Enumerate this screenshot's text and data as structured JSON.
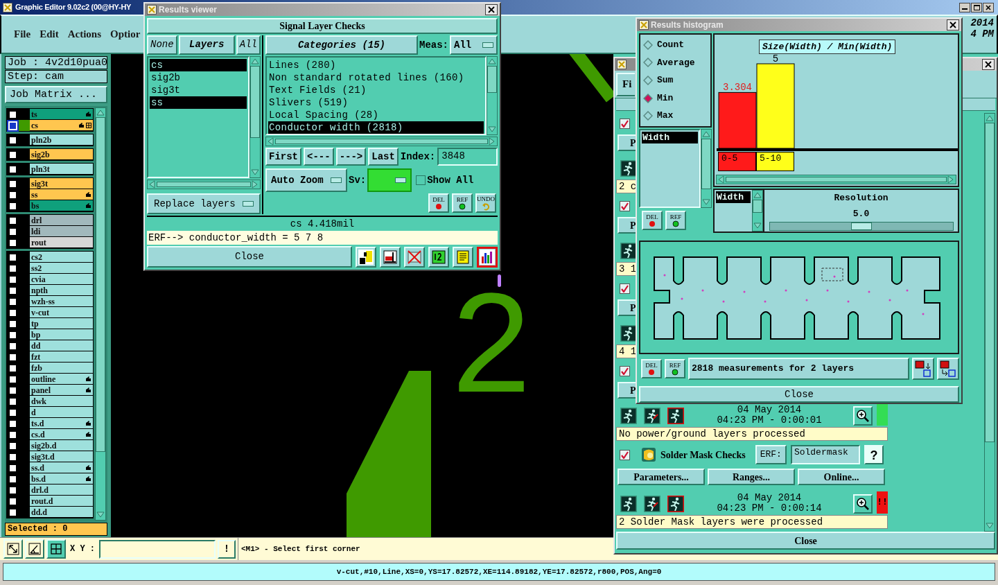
{
  "main_window": {
    "title": "Graphic Editor 9.02c2 (00@HY-HY",
    "menu": [
      "File",
      "Edit",
      "Actions",
      "Optior"
    ],
    "clock": [
      "2014",
      "4 PM"
    ]
  },
  "layer_panel": {
    "job": "Job : 4v2d10pua0",
    "step": "Step: cam",
    "job_matrix_button": "Job Matrix ...",
    "selected_count": "Selected : 0",
    "groups": [
      {
        "layers": [
          {
            "name": "ts",
            "color": "#0fa07c",
            "selected": false,
            "hand": true,
            "grid": false
          },
          {
            "name": "cs",
            "color": "#ffc64f",
            "selected": true,
            "displayed": true,
            "hand": true,
            "grid": true
          }
        ]
      },
      {
        "layers": [
          {
            "name": "pln2b",
            "color": "#9ee0dc",
            "selected": false,
            "hand": false,
            "grid": false
          }
        ]
      },
      {
        "layers": [
          {
            "name": "sig2b",
            "color": "#ffc64f",
            "selected": false,
            "hand": false,
            "grid": false
          }
        ]
      },
      {
        "layers": [
          {
            "name": "pln3t",
            "color": "#9ee0dc",
            "selected": false,
            "hand": false,
            "grid": false
          }
        ]
      },
      {
        "layers": [
          {
            "name": "sig3t",
            "color": "#ffc64f",
            "selected": false,
            "hand": false,
            "grid": false
          },
          {
            "name": "ss",
            "color": "#ffc64f",
            "selected": false,
            "hand": true,
            "grid": false
          },
          {
            "name": "bs",
            "color": "#0fa07c",
            "selected": false,
            "hand": true,
            "grid": false
          }
        ]
      },
      {
        "layers": [
          {
            "name": "drl",
            "color": "#a1b8bc",
            "selected": false,
            "hand": false,
            "grid": false
          },
          {
            "name": "ldi",
            "color": "#a1b8bc",
            "selected": false,
            "hand": false,
            "grid": false
          },
          {
            "name": "rout",
            "color": "#d6d6d6",
            "selected": false,
            "hand": false,
            "grid": false
          }
        ]
      },
      {
        "layers": [
          {
            "name": "cs2",
            "color": "#9ee0dc",
            "selected": false,
            "hand": false,
            "grid": false
          },
          {
            "name": "ss2",
            "color": "#9ee0dc",
            "selected": false,
            "hand": false,
            "grid": false
          },
          {
            "name": "cvia",
            "color": "#9ee0dc",
            "selected": false,
            "hand": false,
            "grid": false
          },
          {
            "name": "npth",
            "color": "#9ee0dc",
            "selected": false,
            "hand": false,
            "grid": false
          },
          {
            "name": "wzh-ss",
            "color": "#9ee0dc",
            "selected": false,
            "hand": false,
            "grid": false
          },
          {
            "name": "v-cut",
            "color": "#9ee0dc",
            "selected": false,
            "hand": false,
            "grid": false
          },
          {
            "name": "tp",
            "color": "#9ee0dc",
            "selected": false,
            "hand": false,
            "grid": false
          },
          {
            "name": "bp",
            "color": "#9ee0dc",
            "selected": false,
            "hand": false,
            "grid": false
          },
          {
            "name": "dd",
            "color": "#9ee0dc",
            "selected": false,
            "hand": false,
            "grid": false
          },
          {
            "name": "fzt",
            "color": "#9ee0dc",
            "selected": false,
            "hand": false,
            "grid": false
          },
          {
            "name": "fzb",
            "color": "#9ee0dc",
            "selected": false,
            "hand": false,
            "grid": false
          },
          {
            "name": "outline",
            "color": "#9ee0dc",
            "selected": false,
            "hand": true,
            "grid": false
          },
          {
            "name": "panel",
            "color": "#9ee0dc",
            "selected": false,
            "hand": true,
            "grid": false
          },
          {
            "name": "dwk",
            "color": "#9ee0dc",
            "selected": false,
            "hand": false,
            "grid": false
          },
          {
            "name": "d",
            "color": "#9ee0dc",
            "selected": false,
            "hand": false,
            "grid": false
          },
          {
            "name": "ts.d",
            "color": "#9ee0dc",
            "selected": false,
            "hand": true,
            "grid": false
          },
          {
            "name": "cs.d",
            "color": "#9ee0dc",
            "selected": false,
            "hand": true,
            "grid": false
          },
          {
            "name": "sig2b.d",
            "color": "#9ee0dc",
            "selected": false,
            "hand": false,
            "grid": false
          },
          {
            "name": "sig3t.d",
            "color": "#9ee0dc",
            "selected": false,
            "hand": false,
            "grid": false
          },
          {
            "name": "ss.d",
            "color": "#9ee0dc",
            "selected": false,
            "hand": true,
            "grid": false
          },
          {
            "name": "bs.d",
            "color": "#9ee0dc",
            "selected": false,
            "hand": true,
            "grid": false
          },
          {
            "name": "drl.d",
            "color": "#9ee0dc",
            "selected": false,
            "hand": false,
            "grid": false
          },
          {
            "name": "rout.d",
            "color": "#9ee0dc",
            "selected": false,
            "hand": false,
            "grid": false
          },
          {
            "name": "dd.d",
            "color": "#9ee0dc",
            "selected": false,
            "hand": false,
            "grid": false
          }
        ]
      }
    ]
  },
  "canvas": {
    "label": "2"
  },
  "results_viewer": {
    "title": "Results viewer",
    "heading": "Signal Layer Checks",
    "layer_buttons": [
      {
        "label": "None",
        "kind": "button"
      },
      {
        "label": "Layers",
        "kind": "label"
      },
      {
        "label": "All",
        "kind": "button"
      }
    ],
    "layers": [
      {
        "name": "cs",
        "selected": true
      },
      {
        "name": "sig2b",
        "selected": false
      },
      {
        "name": "sig3t",
        "selected": false
      },
      {
        "name": "ss",
        "selected": true
      }
    ],
    "replace_button": "Replace layers",
    "categories_header": "Categories (15)",
    "meas_label": "Meas:",
    "meas_value": "All",
    "categories": [
      {
        "label": "Lines (280)",
        "selected": false
      },
      {
        "label": "Non standard rotated lines (160)",
        "selected": false
      },
      {
        "label": "Text Fields (21)",
        "selected": false
      },
      {
        "label": "Slivers (519)",
        "selected": false
      },
      {
        "label": "Local Spacing (28)",
        "selected": false
      },
      {
        "label": "Conductor width (2818)",
        "selected": true
      }
    ],
    "nav_buttons": [
      "First",
      "<---",
      "--->",
      "Last"
    ],
    "index_label": "Index:",
    "index_value": "3848",
    "zoom_button": "Auto Zoom",
    "sv_label": "Sv:",
    "show_all": {
      "label": "Show All",
      "checked": false
    },
    "action_buttons": [
      {
        "label": "DEL",
        "kind": "del"
      },
      {
        "label": "REF",
        "kind": "ref"
      },
      {
        "label": "UNDO",
        "kind": "undo"
      }
    ],
    "reading": "cs 4.418mil",
    "erf_line": "ERF--> conductor_width = 5 7 8",
    "close_button": "Close",
    "tools": [
      {
        "kind": "info",
        "selected": false
      },
      {
        "kind": "marker",
        "selected": false
      },
      {
        "kind": "crossed",
        "selected": false
      },
      {
        "kind": "counter",
        "selected": false
      },
      {
        "kind": "notes",
        "selected": false
      },
      {
        "kind": "histogram",
        "selected": true
      }
    ]
  },
  "results_histogram": {
    "title": "Results histogram",
    "modes": [
      {
        "label": "Count",
        "selected": false
      },
      {
        "label": "Average",
        "selected": false
      },
      {
        "label": "Sum",
        "selected": false
      },
      {
        "label": "Min",
        "selected": true
      },
      {
        "label": "Max",
        "selected": false
      }
    ],
    "attributes": [
      {
        "label": "Width",
        "selected": true
      }
    ],
    "side_buttons": [
      {
        "label": "DEL",
        "kind": "del"
      },
      {
        "label": "REF",
        "kind": "ref"
      }
    ],
    "chart_data": {
      "type": "bar",
      "title": "Size(Width) / Min(Width)",
      "categories": [
        "0-5",
        "5-10"
      ],
      "values": [
        3.304,
        5
      ],
      "data_labels": true
    },
    "axis_attributes": [
      {
        "label": "Width",
        "selected": true
      }
    ],
    "resolution": {
      "label": "Resolution",
      "reading": "5.0",
      "level": 0.5
    },
    "summary_buttons": [
      {
        "label": "DEL",
        "kind": "del"
      },
      {
        "label": "REF",
        "kind": "ref"
      }
    ],
    "summary": "2818 measurements for 2 layers",
    "footer_tools": [
      {
        "kind": "to_board"
      },
      {
        "kind": "to_histogram"
      }
    ],
    "close_button": "Close"
  },
  "checks_window": {
    "menu_fragment": "Fi",
    "sections": [
      {
        "checked": true,
        "button": "P",
        "message": "2 c"
      },
      {
        "checked": true,
        "button": "P",
        "message": "3 1"
      },
      {
        "checked": true,
        "button": "P",
        "message": "4 1"
      },
      {
        "checked": true,
        "button": "P",
        "date": "04 May 2014",
        "time": "04:23 PM - 0:00:01",
        "failed": false,
        "message": "No power/ground layers processed"
      },
      {
        "checked": true,
        "title": "Solder Mask Checks",
        "erf_label": "ERF:",
        "erf_value": "Soldermask",
        "help": "?",
        "buttons": [
          "Parameters...",
          "Ranges...",
          "Online..."
        ],
        "date": "04 May 2014",
        "time": "04:23 PM - 0:00:14",
        "failed": true,
        "status_text": "!!",
        "message": "2 Solder Mask layers were processed"
      }
    ],
    "close_button": "Close"
  },
  "coordinate_bar": {
    "label": "X Y :",
    "button": "!",
    "prompt": "<M1> - Select first corner"
  },
  "status_bar": "v-cut,#10,Line,XS=0,YS=17.82572,XE=114.89182,YE=17.82572,r800,POS,Ang=0"
}
